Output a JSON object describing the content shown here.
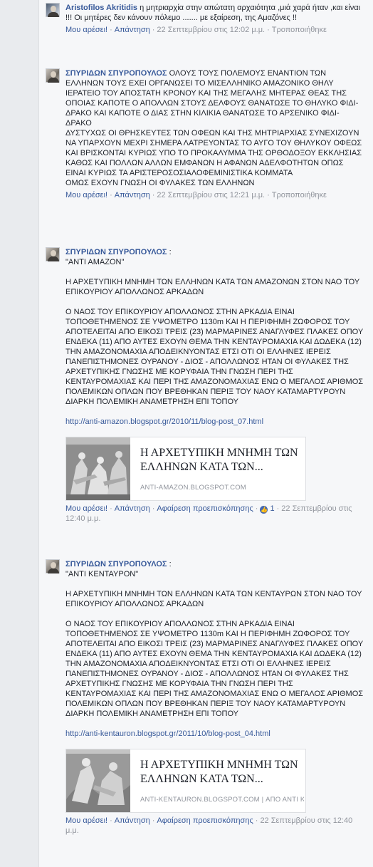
{
  "comments": [
    {
      "author": "Aristofilos Akritidis",
      "text": "η μητριαρχία στην απώτατη αρχαιότητα ,μιά χαρά ήταν ,και είναι !!! Οι μητέρες δεν κάνουν πόλεμο ....... με εξαίρεση, της Αμαζόνες !!",
      "like": "Μου αρέσει!",
      "reply": "Απάντηση",
      "time": "22 Σεπτεμβρίου στις 12:02 μ.μ.",
      "edited": "Τροποποιήθηκε"
    },
    {
      "author": "ΣΠΥΡΙΔΩΝ ΣΠΥΡΟΠΟΥΛΟΣ",
      "text": "ΟΛΟΥΣ ΤΟΥΣ ΠΟΛΕΜΟΥΣ ΕΝΑΝΤΙΟΝ ΤΩΝ ΕΛΛΗΝΩΝ ΤΟΥΣ ΕΧΕΙ ΟΡΓΑΝΩΣΕΙ ΤΟ ΜΙΣΕΛΛΗΝΙΚΟ ΑΜΑΖΟΝΙΚΟ ΘΗΛΥ ΙΕΡΑΤΕΙΟ ΤΟΥ ΑΠΟΣΤΑΤΗ ΚΡΟΝΟΥ ΚΑΙ ΤΗΣ ΜΕΓΑΛΗΣ ΜΗΤΕΡΑΣ ΘΕΑΣ ΤΗΣ ΟΠΟΙΑΣ ΚΑΠΟΤΕ Ο ΑΠΟΛΛΩΝ ΣΤΟΥΣ ΔΕΛΦΟΥΣ ΘΑΝΑΤΩΣΕ ΤΟ ΘΗΛΥΚΟ ΦΙΔΙ-ΔΡΑΚΟ ΚΑΙ ΚΑΠΟΤΕ Ο ΔΙΑΣ ΣΤΗΝ ΚΙΛΙΚΙΑ ΘΑΝΑΤΩΣΕ ΤΟ ΑΡΣΕΝΙΚΟ ΦΙΔΙ-ΔΡΑΚΟ",
      "text2": "ΔΥΣΤΥΧΩΣ ΟΙ ΘΡΗΣΚΕΥΤΕΣ ΤΩΝ ΟΦΕΩΝ ΚΑΙ ΤΗΣ ΜΗΤΡΙΑΡΧΙΑΣ ΣΥΝΕΧΙΖΟΥΝ ΝΑ ΥΠΑΡΧΟΥΝ ΜΕΧΡΙ ΣΗΜΕΡΑ ΛΑΤΡΕΥΟΝΤΑΣ ΤΟ ΑΥΓΟ ΤΟΥ ΘΗΛΥΚΟΥ ΟΦΕΩΣ ΚΑΙ ΒΡΙΣΚΟΝΤΑΙ ΚΥΡΙΩΣ ΥΠΟ ΤΟ ΠΡΟΚΑΛΥΜΜΑ ΤΗΣ ΟΡΘΟΔΟΞΟΥ ΕΚΚΛΗΣΙΑΣ ΚΑΘΩΣ ΚΑΙ ΠΟΛΛΩΝ ΑΛΛΩΝ ΕΜΦΑΝΩΝ Η ΑΦΑΝΩΝ ΑΔΕΛΦΟΤΗΤΩΝ ΟΠΩΣ ΕΙΝΑΙ ΚΥΡΙΩΣ ΤΑ ΑΡΙΣΤΕΡΟΣΟΣΙΑΛΟΦΕΜΙΝΙΣΤΙΚΑ ΚΟΜΜΑΤΑ",
      "text3": "ΟΜΩΣ ΕΧΟΥΝ ΓΝΩΣΗ ΟΙ ΦΥΛΑΚΕΣ ΤΩΝ ΕΛΛΗΝΩΝ",
      "like": "Μου αρέσει!",
      "reply": "Απάντηση",
      "time": "22 Σεπτεμβρίου στις 12:21 μ.μ.",
      "edited": "Τροποποιήθηκε"
    },
    {
      "author": "ΣΠΥΡΙΔΩΝ ΣΠΥΡΟΠΟΥΛΟΣ",
      "author_suffix": " :",
      "quote": "\"ΑΝΤΙ ΑΜΑΖΟΝ\"",
      "heading": "Η ΑΡΧΕΤΥΠΙΚΗ ΜΝΗΜΗ ΤΩΝ ΕΛΛΗΝΩΝ ΚΑΤΑ ΤΩΝ ΑΜΑΖΟΝΩΝ ΣΤΟΝ ΝΑΟ ΤΟΥ ΕΠΙΚΟΥΡΙΟΥ ΑΠΟΛΛΩΝΟΣ ΑΡΚΑΔΩΝ",
      "paragraph": "Ο ΝΑΟΣ ΤΟΥ ΕΠΙΚΟΥΡΙΟΥ ΑΠΟΛΛΩΝΟΣ ΣΤΗΝ ΑΡΚΑΔΙΑ ΕΙΝΑΙ ΤΟΠΟΘΕΤΗΜΕΝΟΣ ΣΕ ΥΨΟΜΕΤΡΟ 1130m ΚΑΙ Η ΠΕΡΙΦΗΜΗ ΖΩΦΟΡΟΣ ΤΟΥ ΑΠΟΤΕΛΕΙΤΑΙ ΑΠΟ ΕΙΚΟΣΙ ΤΡΕΙΣ (23) ΜΑΡΜΑΡΙΝΕΣ ΑΝΑΓΛΥΦΕΣ ΠΛΑΚΕΣ ΟΠΟΥ ΕΝΔΕΚΑ (11) ΑΠΟ ΑΥΤΕΣ ΕΧΟΥΝ ΘΕΜΑ ΤΗΝ ΚΕΝΤΑΥΡΟΜΑΧΙΑ ΚΑΙ ΔΩΔΕΚΑ (12) ΤΗΝ ΑΜΑΖΟΝΟΜΑΧΙΑ ΑΠΟΔΕΙΚΝΥΟΝΤΑΣ ΕΤΣΙ ΟΤΙ ΟΙ ΕΛΛΗΝΕΣ ΙΕΡΕΙΣ ΠΑΝΕΠΙΣΤΗΜΟΝΕΣ ΟΥΡΑΝΟΥ - ΔΙΟΣ - ΑΠΟΛΛΩΝΟΣ ΗΤΑΝ ΟΙ ΦΥΛΑΚΕΣ ΤΗΣ ΑΡΧΕΤΥΠΙΚΗΣ ΓΝΩΣΗΣ ΜΕ ΚΟΡΥΦΑΙΑ ΤΗΝ ΓΝΩΣΗ ΠΕΡΙ ΤΗΣ ΚΕΝΤΑΥΡΟΜΑΧΙΑΣ ΚΑΙ ΠΕΡΙ ΤΗΣ ΑΜΑΖΟΝΟΜΑΧΙΑΣ ΕΝΩ Ο ΜΕΓΑΛΟΣ ΑΡΙΘΜΟΣ ΠΟΛΕΜΙΚΩΝ ΟΠΛΩΝ ΠΟΥ ΒΡΕΘΗΚΑΝ ΠΕΡΙΞ ΤΟΥ ΝΑΟΥ ΚΑΤΑΜΑΡΤΥΡΟΥΝ ΔΙΑΡΚΗ ΠΟΛΕΜΙΚΗ ΑΝΑΜΕΤΡΗΣΗ ΕΠΙ ΤΟΠΟΥ",
      "url": "http://anti-amazon.blogspot.gr/2010/11/blog-post_07.html",
      "preview_title": "Η ΑΡΧΕΤΥΠΙΚΗ ΜΝΗΜΗ ΤΩΝ ΕΛΛΗΝΩΝ ΚΑΤΑ ΤΩΝ...",
      "preview_domain": "ANTI-AMAZON.BLOGSPOT.COM",
      "like": "Μου αρέσει!",
      "reply": "Απάντηση",
      "remove_preview": "Αφαίρεση προεπισκόπησης",
      "like_count": "1",
      "time": "22 Σεπτεμβρίου στις 12:40 μ.μ."
    },
    {
      "author": "ΣΠΥΡΙΔΩΝ ΣΠΥΡΟΠΟΥΛΟΣ",
      "author_suffix": " :",
      "quote": "\"ΑΝΤΙ ΚΕΝΤΑΥΡΟΝ\"",
      "heading": "Η ΑΡΧΕΤΥΠΙΚΗ ΜΝΗΜΗ ΤΩΝ ΕΛΛΗΝΩΝ ΚΑΤΑ ΤΩΝ ΚΕΝΤΑΥΡΩΝ ΣΤΟΝ ΝΑΟ ΤΟΥ ΕΠΙΚΟΥΡΙΟΥ ΑΠΟΛΛΩΝΟΣ ΑΡΚΑΔΩΝ",
      "paragraph": "Ο ΝΑΟΣ ΤΟΥ ΕΠΙΚΟΥΡΙΟΥ ΑΠΟΛΛΩΝΟΣ ΣΤΗΝ ΑΡΚΑΔΙΑ ΕΙΝΑΙ ΤΟΠΟΘΕΤΗΜΕΝΟΣ ΣΕ ΥΨΟΜΕΤΡΟ 1130m ΚΑΙ Η ΠΕΡΙΦΗΜΗ ΖΩΦΟΡΟΣ ΤΟΥ ΑΠΟΤΕΛΕΙΤΑΙ ΑΠΟ ΕΙΚΟΣΙ ΤΡΕΙΣ (23) ΜΑΡΜΑΡΙΝΕΣ ΑΝΑΓΛΥΦΕΣ ΠΛΑΚΕΣ ΟΠΟΥ ΕΝΔΕΚΑ (11) ΑΠΟ ΑΥΤΕΣ ΕΧΟΥΝ ΘΕΜΑ ΤΗΝ ΚΕΝΤΑΥΡΟΜΑΧΙΑ ΚΑΙ ΔΩΔΕΚΑ (12) ΤΗΝ ΑΜΑΖΟΝΟΜΑΧΙΑ ΑΠΟΔΕΙΚΝΥΟΝΤΑΣ ΕΤΣΙ ΟΤΙ ΟΙ ΕΛΛΗΝΕΣ ΙΕΡΕΙΣ ΠΑΝΕΠΙΣΤΗΜΟΝΕΣ ΟΥΡΑΝΟΥ - ΔΙΟΣ - ΑΠΟΛΛΩΝΟΣ ΗΤΑΝ ΟΙ ΦΥΛΑΚΕΣ ΤΗΣ ΑΡΧΕΤΥΠΙΚΗΣ ΓΝΩΣΗΣ ΜΕ ΚΟΡΥΦΑΙΑ ΤΗΝ ΓΝΩΣΗ ΠΕΡΙ ΤΗΣ ΚΕΝΤΑΥΡΟΜΑΧΙΑΣ ΚΑΙ ΠΕΡΙ ΤΗΣ ΑΜΑΖΟΝΟΜΑΧΙΑΣ ΕΝΩ Ο ΜΕΓΑΛΟΣ ΑΡΙΘΜΟΣ ΠΟΛΕΜΙΚΩΝ ΟΠΛΩΝ ΠΟΥ ΒΡΕΘΗΚΑΝ ΠΕΡΙΞ ΤΟΥ ΝΑΟΥ ΚΑΤΑΜΑΡΤΥΡΟΥΝ ΔΙΑΡΚΗ ΠΟΛΕΜΙΚΗ ΑΝΑΜΕΤΡΗΣΗ ΕΠΙ ΤΟΠΟΥ",
      "url": "http://anti-kentauron.blogspot.gr/2011/10/blog-post_04.html",
      "preview_title": "Η ΑΡΧΕΤΥΠΙΚΗ ΜΝΗΜΗ ΤΩΝ ΕΛΛΗΝΩΝ ΚΑΤΑ ΤΩΝ...",
      "preview_domain": "ANTI-KENTAURON.BLOGSPOT.COM | ΑΠΟ ΑΝΤΙ ΚΕ...",
      "like": "Μου αρέσει!",
      "reply": "Απάντηση",
      "remove_preview": "Αφαίρεση προεπισκόπησης",
      "time": "22 Σεπτεμβρίου στις 12:40 μ.μ."
    }
  ],
  "icons": {
    "like": "thumbs-up-icon"
  },
  "colors": {
    "link": "#365899",
    "meta": "#90949c",
    "like_badge": "#4267b2"
  }
}
